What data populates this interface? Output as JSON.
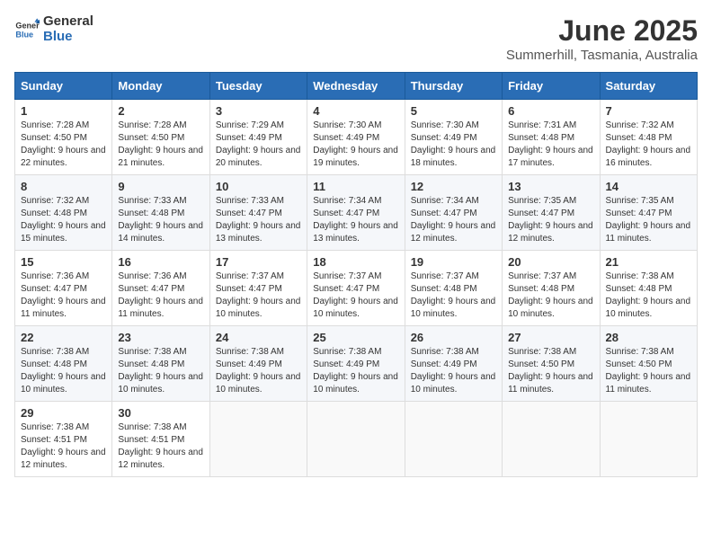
{
  "header": {
    "logo_general": "General",
    "logo_blue": "Blue",
    "month_title": "June 2025",
    "location": "Summerhill, Tasmania, Australia"
  },
  "days_of_week": [
    "Sunday",
    "Monday",
    "Tuesday",
    "Wednesday",
    "Thursday",
    "Friday",
    "Saturday"
  ],
  "weeks": [
    [
      {
        "day": "1",
        "sunrise": "7:28 AM",
        "sunset": "4:50 PM",
        "daylight": "9 hours and 22 minutes."
      },
      {
        "day": "2",
        "sunrise": "7:28 AM",
        "sunset": "4:50 PM",
        "daylight": "9 hours and 21 minutes."
      },
      {
        "day": "3",
        "sunrise": "7:29 AM",
        "sunset": "4:49 PM",
        "daylight": "9 hours and 20 minutes."
      },
      {
        "day": "4",
        "sunrise": "7:30 AM",
        "sunset": "4:49 PM",
        "daylight": "9 hours and 19 minutes."
      },
      {
        "day": "5",
        "sunrise": "7:30 AM",
        "sunset": "4:49 PM",
        "daylight": "9 hours and 18 minutes."
      },
      {
        "day": "6",
        "sunrise": "7:31 AM",
        "sunset": "4:48 PM",
        "daylight": "9 hours and 17 minutes."
      },
      {
        "day": "7",
        "sunrise": "7:32 AM",
        "sunset": "4:48 PM",
        "daylight": "9 hours and 16 minutes."
      }
    ],
    [
      {
        "day": "8",
        "sunrise": "7:32 AM",
        "sunset": "4:48 PM",
        "daylight": "9 hours and 15 minutes."
      },
      {
        "day": "9",
        "sunrise": "7:33 AM",
        "sunset": "4:48 PM",
        "daylight": "9 hours and 14 minutes."
      },
      {
        "day": "10",
        "sunrise": "7:33 AM",
        "sunset": "4:47 PM",
        "daylight": "9 hours and 13 minutes."
      },
      {
        "day": "11",
        "sunrise": "7:34 AM",
        "sunset": "4:47 PM",
        "daylight": "9 hours and 13 minutes."
      },
      {
        "day": "12",
        "sunrise": "7:34 AM",
        "sunset": "4:47 PM",
        "daylight": "9 hours and 12 minutes."
      },
      {
        "day": "13",
        "sunrise": "7:35 AM",
        "sunset": "4:47 PM",
        "daylight": "9 hours and 12 minutes."
      },
      {
        "day": "14",
        "sunrise": "7:35 AM",
        "sunset": "4:47 PM",
        "daylight": "9 hours and 11 minutes."
      }
    ],
    [
      {
        "day": "15",
        "sunrise": "7:36 AM",
        "sunset": "4:47 PM",
        "daylight": "9 hours and 11 minutes."
      },
      {
        "day": "16",
        "sunrise": "7:36 AM",
        "sunset": "4:47 PM",
        "daylight": "9 hours and 11 minutes."
      },
      {
        "day": "17",
        "sunrise": "7:37 AM",
        "sunset": "4:47 PM",
        "daylight": "9 hours and 10 minutes."
      },
      {
        "day": "18",
        "sunrise": "7:37 AM",
        "sunset": "4:47 PM",
        "daylight": "9 hours and 10 minutes."
      },
      {
        "day": "19",
        "sunrise": "7:37 AM",
        "sunset": "4:48 PM",
        "daylight": "9 hours and 10 minutes."
      },
      {
        "day": "20",
        "sunrise": "7:37 AM",
        "sunset": "4:48 PM",
        "daylight": "9 hours and 10 minutes."
      },
      {
        "day": "21",
        "sunrise": "7:38 AM",
        "sunset": "4:48 PM",
        "daylight": "9 hours and 10 minutes."
      }
    ],
    [
      {
        "day": "22",
        "sunrise": "7:38 AM",
        "sunset": "4:48 PM",
        "daylight": "9 hours and 10 minutes."
      },
      {
        "day": "23",
        "sunrise": "7:38 AM",
        "sunset": "4:48 PM",
        "daylight": "9 hours and 10 minutes."
      },
      {
        "day": "24",
        "sunrise": "7:38 AM",
        "sunset": "4:49 PM",
        "daylight": "9 hours and 10 minutes."
      },
      {
        "day": "25",
        "sunrise": "7:38 AM",
        "sunset": "4:49 PM",
        "daylight": "9 hours and 10 minutes."
      },
      {
        "day": "26",
        "sunrise": "7:38 AM",
        "sunset": "4:49 PM",
        "daylight": "9 hours and 10 minutes."
      },
      {
        "day": "27",
        "sunrise": "7:38 AM",
        "sunset": "4:50 PM",
        "daylight": "9 hours and 11 minutes."
      },
      {
        "day": "28",
        "sunrise": "7:38 AM",
        "sunset": "4:50 PM",
        "daylight": "9 hours and 11 minutes."
      }
    ],
    [
      {
        "day": "29",
        "sunrise": "7:38 AM",
        "sunset": "4:51 PM",
        "daylight": "9 hours and 12 minutes."
      },
      {
        "day": "30",
        "sunrise": "7:38 AM",
        "sunset": "4:51 PM",
        "daylight": "9 hours and 12 minutes."
      },
      null,
      null,
      null,
      null,
      null
    ]
  ],
  "labels": {
    "sunrise": "Sunrise:",
    "sunset": "Sunset:",
    "daylight": "Daylight:"
  }
}
